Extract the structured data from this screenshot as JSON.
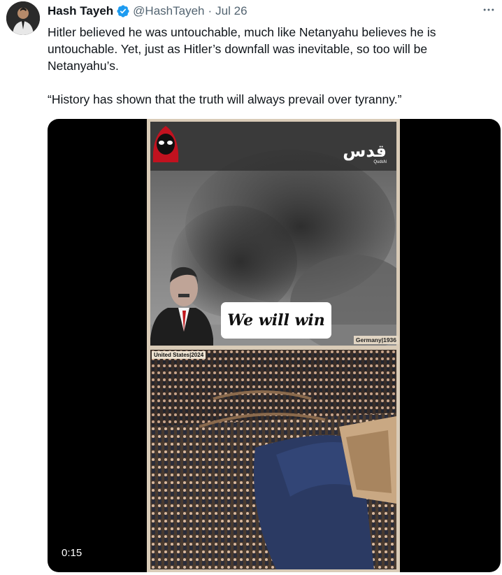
{
  "author": {
    "name": "Hash Tayeh",
    "handle": "@HashTayeh",
    "separator": "·",
    "date": "Jul 26"
  },
  "tweet": {
    "paragraph1": "Hitler believed he was untouchable, much like Netanyahu believes he is untouchable. Yet, just as Hitler’s downfall was inevitable, so too will be Netanyahu’s.",
    "paragraph2": "“History has shown that the truth will always prevail over tyranny.”"
  },
  "video": {
    "caption": "We will win",
    "label_top": "Germany|1936",
    "label_bottom": "United States|2024",
    "logo": "قدس",
    "logo_sub": "QudsN",
    "timestamp": "0:15"
  },
  "colors": {
    "verified": "#1d9bf0",
    "text": "#0f1419",
    "secondary": "#536471",
    "media_bg": "#000000"
  },
  "icons": {
    "verified": "verified-badge-icon",
    "more": "more-options-icon"
  }
}
